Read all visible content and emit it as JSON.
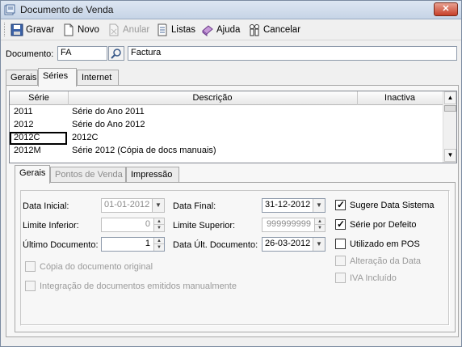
{
  "window": {
    "title": "Documento de Venda",
    "close_glyph": "✕"
  },
  "toolbar": {
    "gravar": "Gravar",
    "novo": "Novo",
    "anular": "Anular",
    "listas": "Listas",
    "ajuda": "Ajuda",
    "cancelar": "Cancelar"
  },
  "documento": {
    "label": "Documento:",
    "code": "FA",
    "name": "Factura"
  },
  "top_tabs": [
    "Gerais",
    "Séries",
    "Internet"
  ],
  "series_grid": {
    "headers": {
      "serie": "Série",
      "descricao": "Descrição",
      "inactiva": "Inactiva"
    },
    "rows": [
      {
        "serie": "2011",
        "descricao": "Série do Ano 2011"
      },
      {
        "serie": "2012",
        "descricao": "Série do Ano 2012"
      },
      {
        "serie": "2012C",
        "descricao": "2012C"
      },
      {
        "serie": "2012M",
        "descricao": "Série 2012 (Cópia de docs manuais)"
      }
    ],
    "selected_row": 2
  },
  "inner_tabs": [
    "Gerais",
    "Pontos de Venda",
    "Impressão"
  ],
  "gerais": {
    "data_inicial_label": "Data Inicial:",
    "data_inicial": "01-01-2012",
    "data_final_label": "Data Final:",
    "data_final": "31-12-2012",
    "limite_inferior_label": "Limite Inferior:",
    "limite_inferior": "0",
    "limite_superior_label": "Limite Superior:",
    "limite_superior": "999999999",
    "ultimo_doc_label": "Último Documento:",
    "ultimo_doc": "1",
    "data_ult_doc_label": "Data Últ. Documento:",
    "data_ult_doc": "26-03-2012",
    "copia_label": "Cópia do documento original",
    "integracao_label": "Integração de documentos emitidos manualmente",
    "sugere_label": "Sugere Data Sistema",
    "serie_defeito_label": "Série por Defeito",
    "utilizado_pos_label": "Utilizado em POS",
    "alteracao_label": "Alteração da Data",
    "iva_label": "IVA Incluído"
  },
  "checkbox_states": {
    "sugere": true,
    "serie_defeito": true,
    "utilizado_pos": false,
    "alteracao": false,
    "iva": false,
    "copia": false,
    "integracao": false
  },
  "colors": {
    "accent_close": "#c7402a",
    "field_border": "#8e9aab",
    "disabled_text": "#9a9a9a"
  }
}
